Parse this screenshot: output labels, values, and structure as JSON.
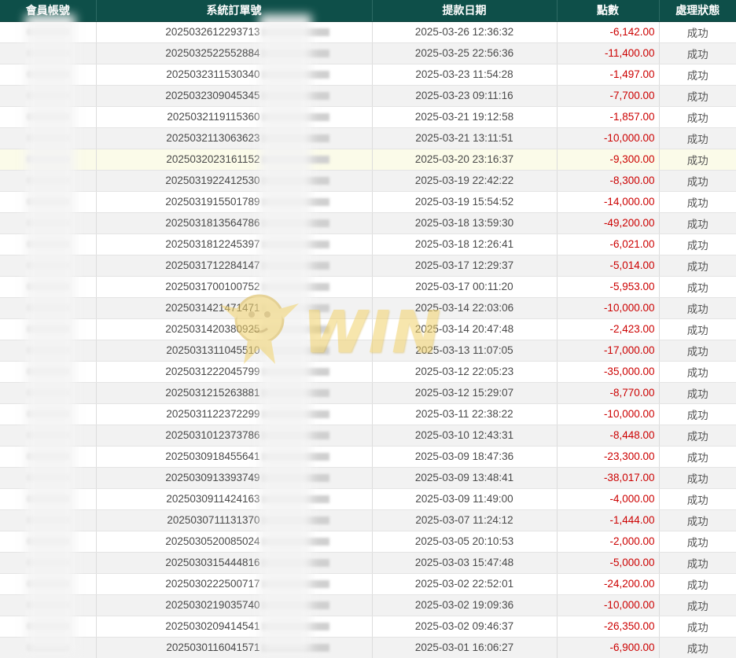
{
  "table": {
    "columns": [
      "會員帳號",
      "系統訂單號",
      "提款日期",
      "點數",
      "處理狀態"
    ],
    "rows": [
      {
        "order": "2025032612293713",
        "date": "2025-03-26 12:36:32",
        "points": "-6,142.00",
        "status": "成功"
      },
      {
        "order": "2025032522552884",
        "date": "2025-03-25 22:56:36",
        "points": "-11,400.00",
        "status": "成功"
      },
      {
        "order": "2025032311530340",
        "date": "2025-03-23 11:54:28",
        "points": "-1,497.00",
        "status": "成功"
      },
      {
        "order": "2025032309045345",
        "date": "2025-03-23 09:11:16",
        "points": "-7,700.00",
        "status": "成功"
      },
      {
        "order": "2025032119115360",
        "date": "2025-03-21 19:12:58",
        "points": "-1,857.00",
        "status": "成功"
      },
      {
        "order": "2025032113063623",
        "date": "2025-03-21 13:11:51",
        "points": "-10,000.00",
        "status": "成功"
      },
      {
        "order": "2025032023161152",
        "date": "2025-03-20 23:16:37",
        "points": "-9,300.00",
        "status": "成功",
        "highlight": true
      },
      {
        "order": "2025031922412530",
        "date": "2025-03-19 22:42:22",
        "points": "-8,300.00",
        "status": "成功"
      },
      {
        "order": "2025031915501789",
        "date": "2025-03-19 15:54:52",
        "points": "-14,000.00",
        "status": "成功"
      },
      {
        "order": "2025031813564786",
        "date": "2025-03-18 13:59:30",
        "points": "-49,200.00",
        "status": "成功"
      },
      {
        "order": "2025031812245397",
        "date": "2025-03-18 12:26:41",
        "points": "-6,021.00",
        "status": "成功"
      },
      {
        "order": "2025031712284147",
        "date": "2025-03-17 12:29:37",
        "points": "-5,014.00",
        "status": "成功"
      },
      {
        "order": "2025031700100752",
        "date": "2025-03-17 00:11:20",
        "points": "-5,953.00",
        "status": "成功"
      },
      {
        "order": "2025031421471471",
        "date": "2025-03-14 22:03:06",
        "points": "-10,000.00",
        "status": "成功"
      },
      {
        "order": "2025031420380925",
        "date": "2025-03-14 20:47:48",
        "points": "-2,423.00",
        "status": "成功"
      },
      {
        "order": "2025031311045510",
        "date": "2025-03-13 11:07:05",
        "points": "-17,000.00",
        "status": "成功"
      },
      {
        "order": "2025031222045799",
        "date": "2025-03-12 22:05:23",
        "points": "-35,000.00",
        "status": "成功"
      },
      {
        "order": "2025031215263881",
        "date": "2025-03-12 15:29:07",
        "points": "-8,770.00",
        "status": "成功"
      },
      {
        "order": "2025031122372299",
        "date": "2025-03-11 22:38:22",
        "points": "-10,000.00",
        "status": "成功"
      },
      {
        "order": "2025031012373786",
        "date": "2025-03-10 12:43:31",
        "points": "-8,448.00",
        "status": "成功"
      },
      {
        "order": "2025030918455641",
        "date": "2025-03-09 18:47:36",
        "points": "-23,300.00",
        "status": "成功"
      },
      {
        "order": "2025030913393749",
        "date": "2025-03-09 13:48:41",
        "points": "-38,017.00",
        "status": "成功"
      },
      {
        "order": "2025030911424163",
        "date": "2025-03-09 11:49:00",
        "points": "-4,000.00",
        "status": "成功"
      },
      {
        "order": "2025030711131370",
        "date": "2025-03-07 11:24:12",
        "points": "-1,444.00",
        "status": "成功"
      },
      {
        "order": "2025030520085024",
        "date": "2025-03-05 20:10:53",
        "points": "-2,000.00",
        "status": "成功"
      },
      {
        "order": "2025030315444816",
        "date": "2025-03-03 15:47:48",
        "points": "-5,000.00",
        "status": "成功"
      },
      {
        "order": "2025030222500717",
        "date": "2025-03-02 22:52:01",
        "points": "-24,200.00",
        "status": "成功"
      },
      {
        "order": "2025030219035740",
        "date": "2025-03-02 19:09:36",
        "points": "-10,000.00",
        "status": "成功"
      },
      {
        "order": "2025030209414541",
        "date": "2025-03-02 09:46:37",
        "points": "-26,350.00",
        "status": "成功"
      },
      {
        "order": "2025030116041571",
        "date": "2025-03-01 16:06:27",
        "points": "-6,900.00",
        "status": "成功"
      }
    ]
  },
  "colors": {
    "header_bg": "#0e4f49",
    "header_text": "#ffffff",
    "points_negative": "#cc0000",
    "row_alt": "#f2f2f2",
    "row_highlight": "#fbfbe9"
  },
  "watermark": {
    "icon": "lion-logo-icon",
    "text": "WIN"
  }
}
